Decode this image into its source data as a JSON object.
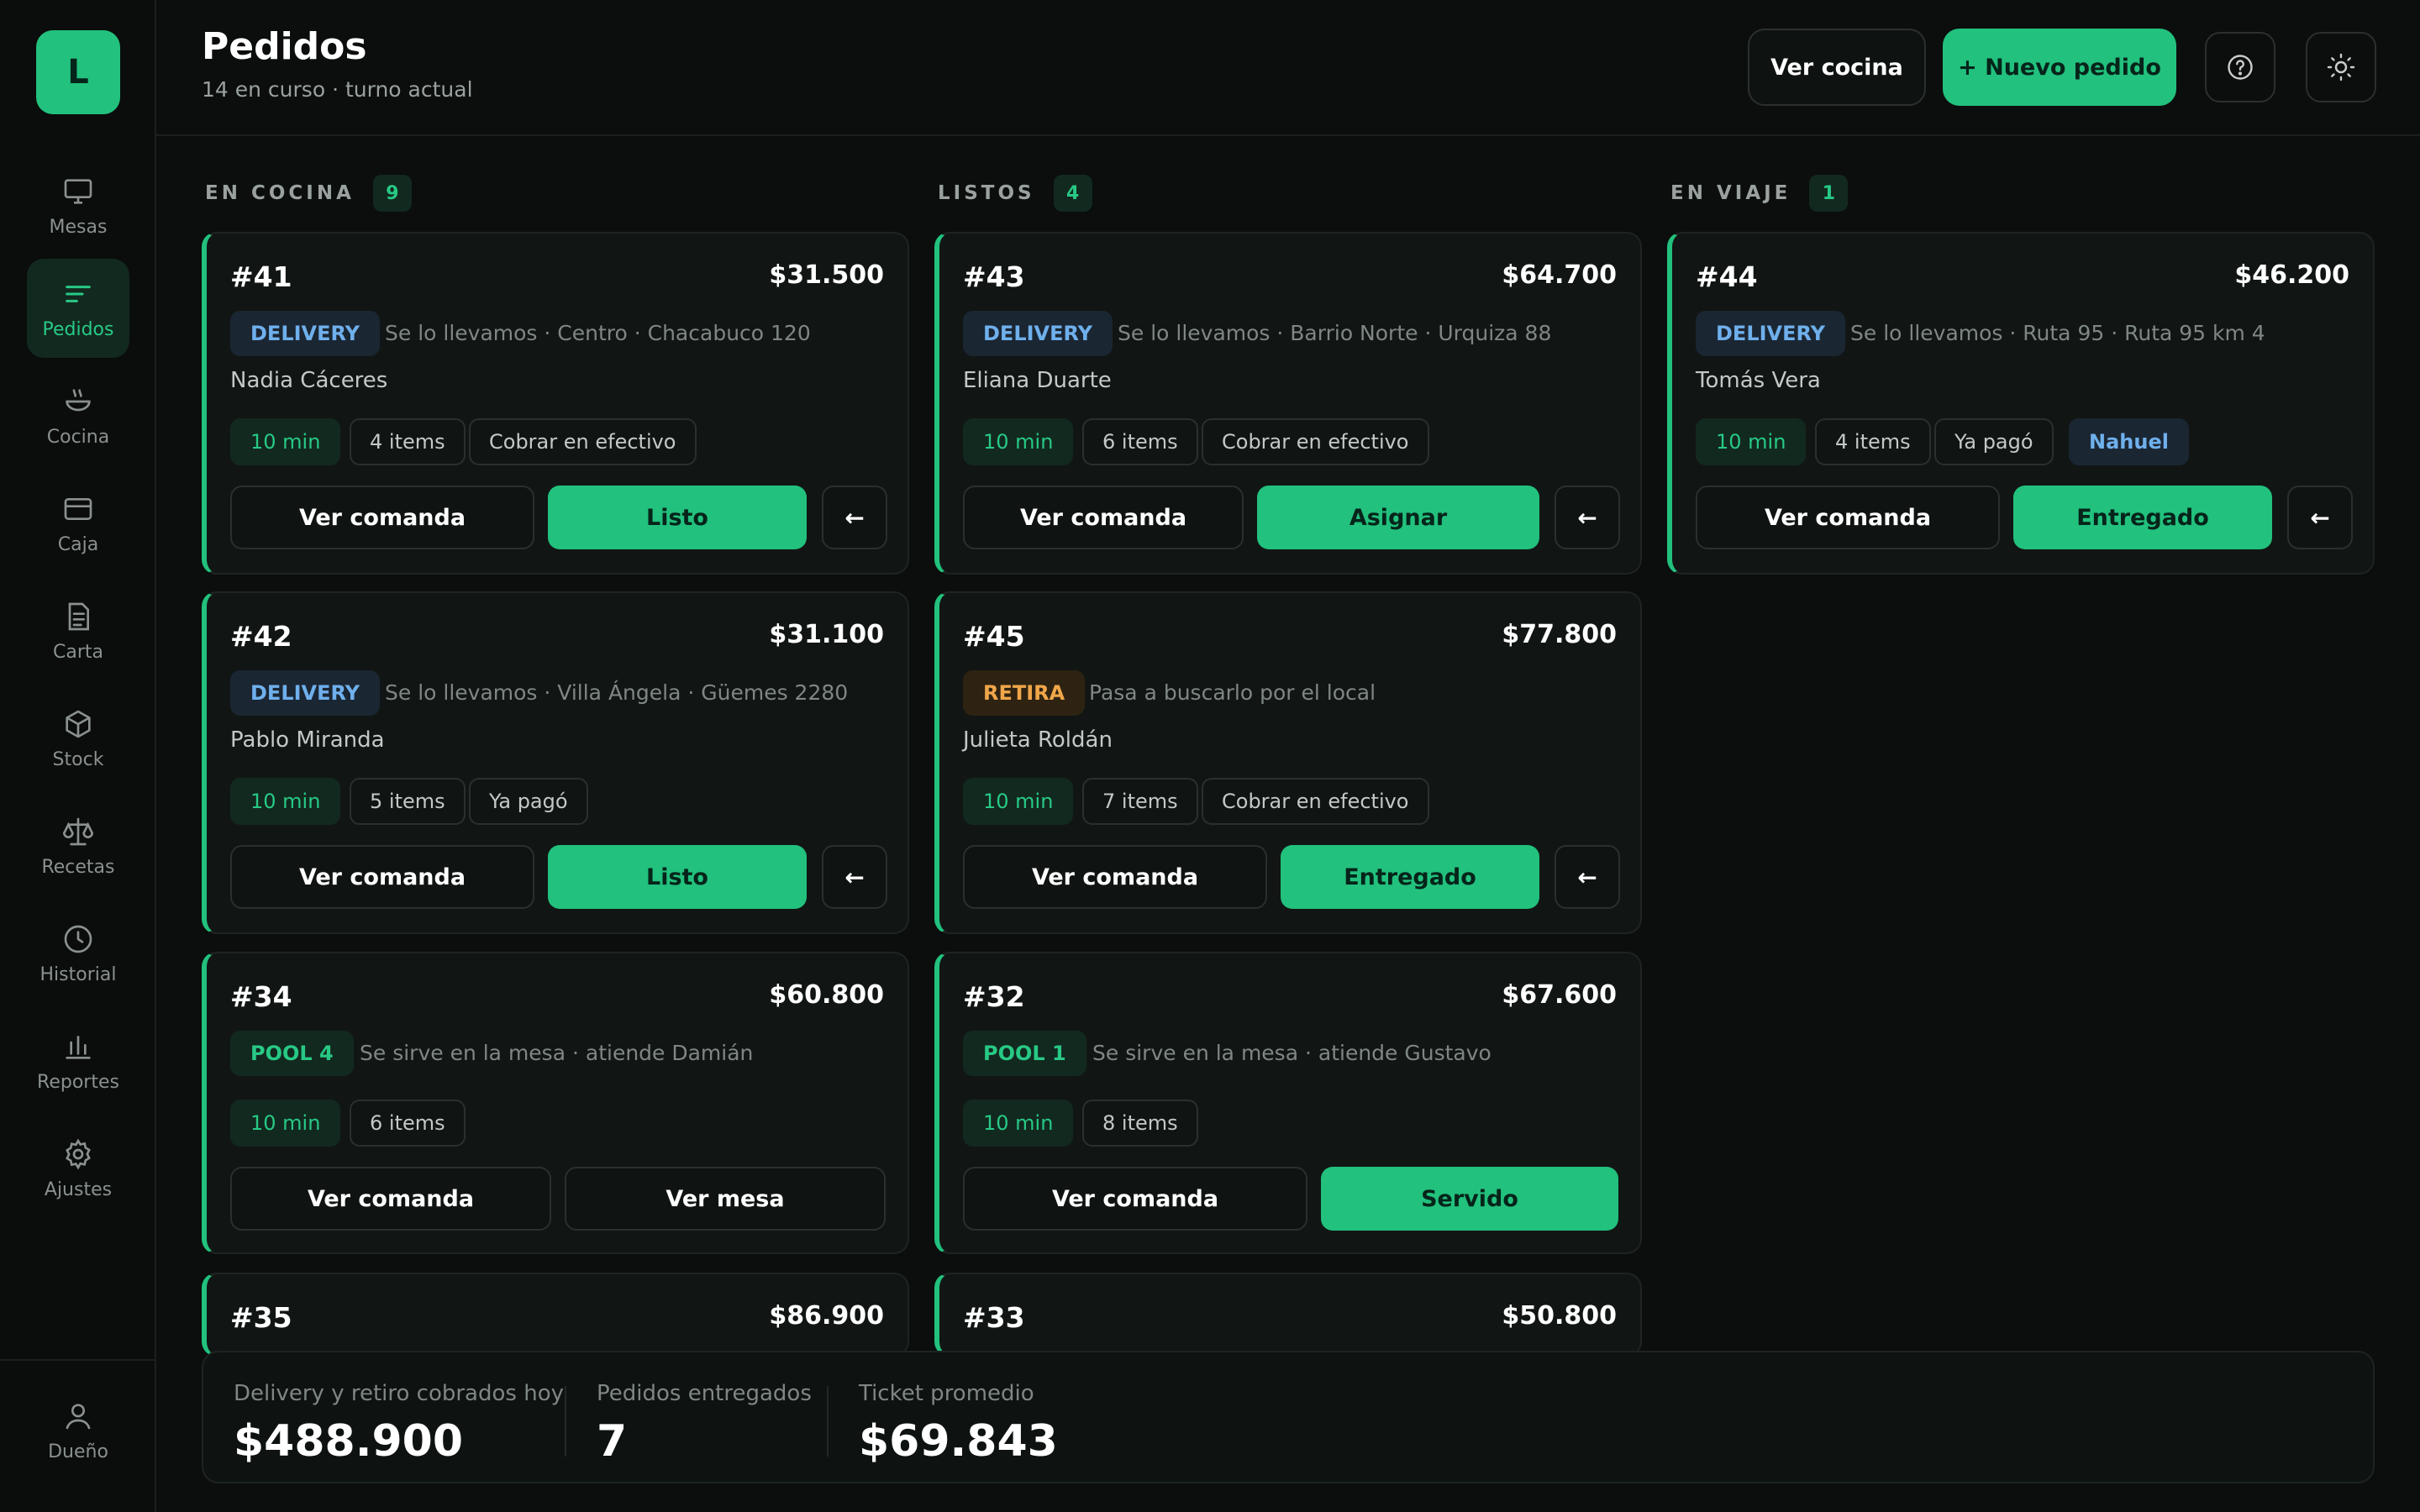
{
  "app": {
    "logo_letter": "L"
  },
  "sidebar": {
    "items": [
      {
        "label": "Mesas",
        "icon": "monitor-icon"
      },
      {
        "label": "Pedidos",
        "icon": "list-icon",
        "active": true
      },
      {
        "label": "Cocina",
        "icon": "pot-icon"
      },
      {
        "label": "Caja",
        "icon": "credit-card-icon"
      },
      {
        "label": "Carta",
        "icon": "document-icon"
      },
      {
        "label": "Stock",
        "icon": "box-icon"
      },
      {
        "label": "Recetas",
        "icon": "scale-icon"
      },
      {
        "label": "Historial",
        "icon": "clock-icon"
      },
      {
        "label": "Reportes",
        "icon": "bar-chart-icon"
      },
      {
        "label": "Ajustes",
        "icon": "gear-icon"
      }
    ],
    "user": {
      "label": "Dueño",
      "icon": "user-icon"
    }
  },
  "header": {
    "title": "Pedidos",
    "subtitle": "14 en curso · turno actual",
    "ver_cocina": "Ver cocina",
    "nuevo_pedido": "+ Nuevo pedido",
    "help_icon": "help-circle-icon",
    "theme_icon": "sun-icon"
  },
  "columns": [
    {
      "title": "EN COCINA",
      "count": "9"
    },
    {
      "title": "LISTOS",
      "count": "4"
    },
    {
      "title": "EN VIAJE",
      "count": "1"
    }
  ],
  "cards": {
    "c41": {
      "num": "#41",
      "total": "$31.500",
      "badge": "DELIVERY",
      "info": "Se lo llevamos · Centro · Chacabuco 120",
      "client": "Nadia Cáceres",
      "time": "10 min",
      "items": "4 items",
      "pay": "Cobrar en efectivo",
      "b1": "Ver comanda",
      "b2": "Listo",
      "back": "←"
    },
    "c42": {
      "num": "#42",
      "total": "$31.100",
      "badge": "DELIVERY",
      "info": "Se lo llevamos · Villa Ángela · Güemes 2280",
      "client": "Pablo Miranda",
      "time": "10 min",
      "items": "5 items",
      "pay": "Ya pagó",
      "b1": "Ver comanda",
      "b2": "Listo",
      "back": "←"
    },
    "c34": {
      "num": "#34",
      "total": "$60.800",
      "badge": "POOL 4",
      "info": "Se sirve en la mesa · atiende Damián",
      "time": "10 min",
      "items": "6 items",
      "b1": "Ver comanda",
      "b2": "Ver mesa"
    },
    "c35": {
      "num": "#35",
      "total": "$86.900"
    },
    "c43": {
      "num": "#43",
      "total": "$64.700",
      "badge": "DELIVERY",
      "info": "Se lo llevamos · Barrio Norte · Urquiza 88",
      "client": "Eliana Duarte",
      "time": "10 min",
      "items": "6 items",
      "pay": "Cobrar en efectivo",
      "b1": "Ver comanda",
      "b2": "Asignar",
      "back": "←"
    },
    "c45": {
      "num": "#45",
      "total": "$77.800",
      "badge": "RETIRA",
      "info": "Pasa a buscarlo por el local",
      "client": "Julieta Roldán",
      "time": "10 min",
      "items": "7 items",
      "pay": "Cobrar en efectivo",
      "b1": "Ver comanda",
      "b2": "Entregado",
      "back": "←"
    },
    "c32": {
      "num": "#32",
      "total": "$67.600",
      "badge": "POOL 1",
      "info": "Se sirve en la mesa · atiende Gustavo",
      "time": "10 min",
      "items": "8 items",
      "b1": "Ver comanda",
      "b2": "Servido"
    },
    "c33": {
      "num": "#33",
      "total": "$50.800"
    },
    "c44": {
      "num": "#44",
      "total": "$46.200",
      "badge": "DELIVERY",
      "info": "Se lo llevamos · Ruta 95 · Ruta 95 km 4",
      "client": "Tomás Vera",
      "time": "10 min",
      "items": "4 items",
      "pay": "Ya pagó",
      "person": "Nahuel",
      "b1": "Ver comanda",
      "b2": "Entregado",
      "back": "←"
    }
  },
  "summary": {
    "s1_label": "Delivery y retiro cobrados hoy",
    "s1_value": "$488.900",
    "s2_label": "Pedidos entregados",
    "s2_value": "7",
    "s3_label": "Ticket promedio",
    "s3_value": "$69.843"
  },
  "colors": {
    "accent": "#22c17d",
    "background": "#0b0e0d",
    "delivery": "#6fb0ec",
    "retira": "#f0a64a"
  }
}
